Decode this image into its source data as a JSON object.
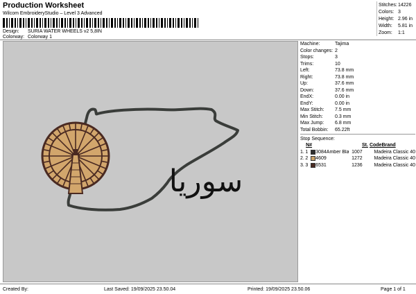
{
  "header": {
    "title": "Production Worksheet",
    "subtitle": "Wilcom EmbroideryStudio – Level 3 Advanced",
    "design_key": "Design:",
    "design_value": "SURIA WATER WHEELS v2 5,8IN",
    "colorway_key": "Colorway:",
    "colorway_value": "Colorway 1"
  },
  "summary": [
    {
      "k": "Stitches:",
      "v": "14226"
    },
    {
      "k": "Colors:",
      "v": "3"
    },
    {
      "k": "Height:",
      "v": "2.96 in"
    },
    {
      "k": "Width:",
      "v": "5.81 in"
    },
    {
      "k": "Zoom:",
      "v": "1:1"
    }
  ],
  "details": [
    {
      "k": "Machine:",
      "v": "Tajima"
    },
    {
      "k": "Color changes:",
      "v": "2"
    },
    {
      "k": "Stops:",
      "v": "3"
    },
    {
      "k": "Trims:",
      "v": "10"
    },
    {
      "k": "Left:",
      "v": "73.8 mm"
    },
    {
      "k": "Right:",
      "v": "73.8 mm"
    },
    {
      "k": "Up:",
      "v": "37.6 mm"
    },
    {
      "k": "Down:",
      "v": "37.6 mm"
    },
    {
      "k": "EndX:",
      "v": "0.00 in"
    },
    {
      "k": "EndY:",
      "v": "0.00 in"
    },
    {
      "k": "Max Stitch:",
      "v": "7.5 mm"
    },
    {
      "k": "Min Stitch:",
      "v": "0.3 mm"
    },
    {
      "k": "Max Jump:",
      "v": "6.8 mm"
    },
    {
      "k": "Total Bobbin:",
      "v": "65.22ft"
    }
  ],
  "stops": {
    "title": "Stop Sequence:",
    "headers": {
      "n": "N#",
      "st": "St.",
      "code": "Code",
      "brand": "Brand"
    },
    "rows": [
      {
        "idx": "1.",
        "n": "1",
        "swatch": "#2e2e2e",
        "code": "3084",
        "name": "Amber Black",
        "st": "1007",
        "brand": "Madeira Classic 40"
      },
      {
        "idx": "2.",
        "n": "2",
        "swatch": "#c9a269",
        "code": "4609",
        "name": "",
        "st": "1272",
        "brand": "Madeira Classic 40"
      },
      {
        "idx": "3.",
        "n": "3",
        "swatch": "#4a2a22",
        "code": "6531",
        "name": "",
        "st": "1236",
        "brand": "Madeira Classic 40"
      }
    ]
  },
  "footer": {
    "created_by": "Created By:",
    "last_saved": "Last Saved: 19/09/2025 23.50.04",
    "printed": "Printed: 19/09/2025 23.50.06",
    "page": "Page 1 of 1"
  },
  "design_text": "سوريا"
}
